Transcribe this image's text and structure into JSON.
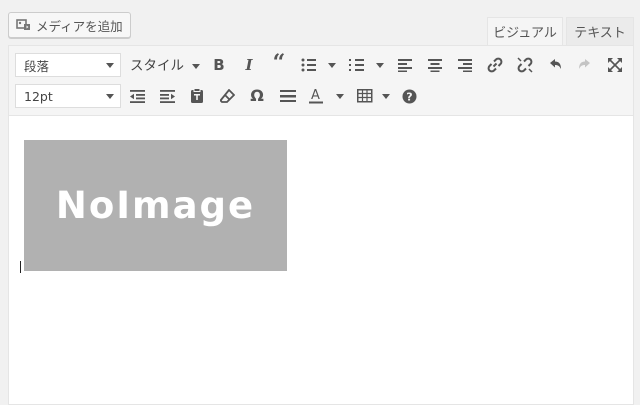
{
  "media_button": {
    "label": "メディアを追加",
    "icon": "media-icon"
  },
  "tabs": [
    {
      "label": "ビジュアル",
      "active": true
    },
    {
      "label": "テキスト",
      "active": false
    }
  ],
  "toolbar": {
    "format_select": "段落",
    "style_dropdown": "スタイル",
    "font_size_select": "12pt"
  },
  "content": {
    "image_text": "NoImage",
    "image_color": "#b1b1b1"
  }
}
